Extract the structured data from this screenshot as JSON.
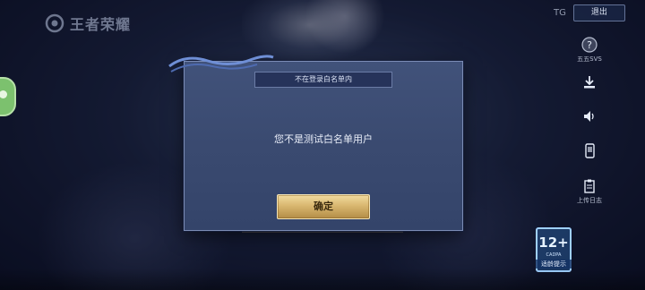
{
  "logo": {
    "text": "王者荣耀",
    "icon": "logo-emblem-icon"
  },
  "header": {
    "tg_label": "TG",
    "logout_label": "退出"
  },
  "right_tools": [
    {
      "icon": "question-icon",
      "label": "五五SVS"
    },
    {
      "icon": "download-icon",
      "label": ""
    },
    {
      "icon": "speaker-icon",
      "label": ""
    },
    {
      "icon": "phone-icon",
      "label": ""
    },
    {
      "icon": "clipboard-icon",
      "label": "上传日志"
    }
  ],
  "age_rating": {
    "number": "12+",
    "sub": "CADPA",
    "label": "适龄提示"
  },
  "dialog": {
    "title": "不在登录白名单内",
    "message": "您不是测试白名单用户",
    "confirm_label": "确定"
  },
  "colors": {
    "dialog_bg": "#3a4a70",
    "confirm_gold": "#d9b770",
    "age_border": "#9fd0ff"
  }
}
